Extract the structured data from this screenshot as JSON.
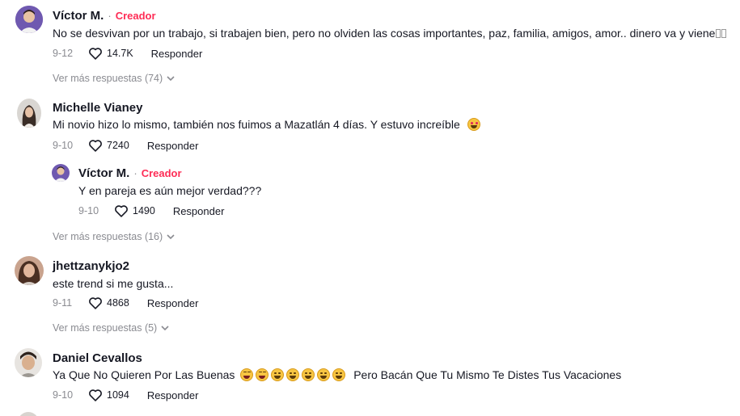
{
  "comments": [
    {
      "author": "Víctor M.",
      "separator": "·",
      "creator_badge": "Creador",
      "text": "No se desvivan por un trabajo, si trabajen bien, pero no olviden las cosas importantes, paz, familia, amigos, amor.. dinero va y viene",
      "date": "9-12",
      "likes": "14.7K",
      "reply_label": "Responder",
      "more_replies": "Ver más respuestas (74)"
    },
    {
      "author": "Michelle Vianey",
      "text": "Mi novio hizo lo mismo, también nos fuimos a Mazatlán 4 días. Y estuvo increíble",
      "date": "9-10",
      "likes": "7240",
      "reply_label": "Responder",
      "reply": {
        "author": "Víctor M.",
        "separator": "·",
        "creator_badge": "Creador",
        "text": "Y en pareja es aún mejor verdad???",
        "date": "9-10",
        "likes": "1490",
        "reply_label": "Responder"
      },
      "more_replies": "Ver más respuestas (16)"
    },
    {
      "author": "jhettzanykjo2",
      "text": "este trend si me gusta...",
      "date": "9-11",
      "likes": "4868",
      "reply_label": "Responder",
      "more_replies": "Ver más respuestas (5)"
    },
    {
      "author": "Daniel Cevallos",
      "text": "Pero Bacán Que Tu Mismo Te Distes Tus Vacaciones",
      "text_prefix": "Ya Que No Quieren Por Las Buenas",
      "date": "9-10",
      "likes": "1094",
      "reply_label": "Responder"
    }
  ],
  "icons": {
    "like": "heart-outline-icon",
    "more": "chevron-down-icon"
  },
  "colors": {
    "creator": "#fe2c55",
    "muted": "#8a8b91",
    "text": "#161823"
  }
}
